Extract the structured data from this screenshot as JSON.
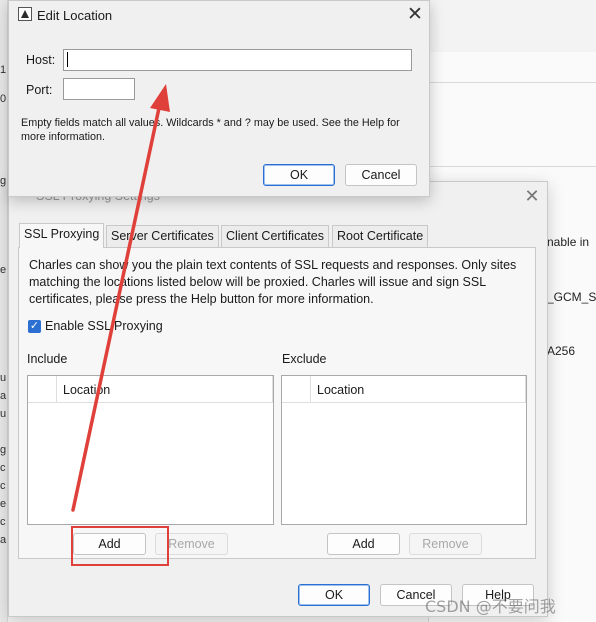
{
  "background": {
    "right_fragments": [
      "nable in",
      "_GCM_SH",
      "A256"
    ],
    "left_letters": [
      "1",
      "0",
      "g",
      "e",
      "u",
      "a",
      "u",
      "g",
      "c",
      "c",
      "e",
      "c",
      "a"
    ]
  },
  "ssl_window": {
    "title": "SSL Proxying Settings",
    "tabs": [
      {
        "label": "SSL Proxying",
        "active": true
      },
      {
        "label": "Server Certificates",
        "active": false
      },
      {
        "label": "Client Certificates",
        "active": false
      },
      {
        "label": "Root Certificate",
        "active": false
      }
    ],
    "description": "Charles can show you the plain text contents of SSL requests and responses. Only sites matching the locations listed below will be proxied. Charles will issue and sign SSL certificates, please press the Help button for more information.",
    "enable_checkbox": {
      "label": "Enable SSL Proxying",
      "checked": true
    },
    "include": {
      "label": "Include",
      "column": "Location",
      "add": "Add",
      "remove": "Remove"
    },
    "exclude": {
      "label": "Exclude",
      "column": "Location",
      "add": "Add",
      "remove": "Remove"
    },
    "footer": {
      "ok": "OK",
      "cancel": "Cancel",
      "help": "Help"
    }
  },
  "edit_dialog": {
    "title": "Edit Location",
    "host_label": "Host:",
    "host_value": "",
    "port_label": "Port:",
    "port_value": "",
    "hint": "Empty fields match all values. Wildcards * and ? may be used. See the Help for more information.",
    "ok": "OK",
    "cancel": "Cancel"
  },
  "annotation": {
    "arrow_color": "#e0403a",
    "box_color": "#e0403a"
  },
  "watermark": "CSDN @不要问我"
}
